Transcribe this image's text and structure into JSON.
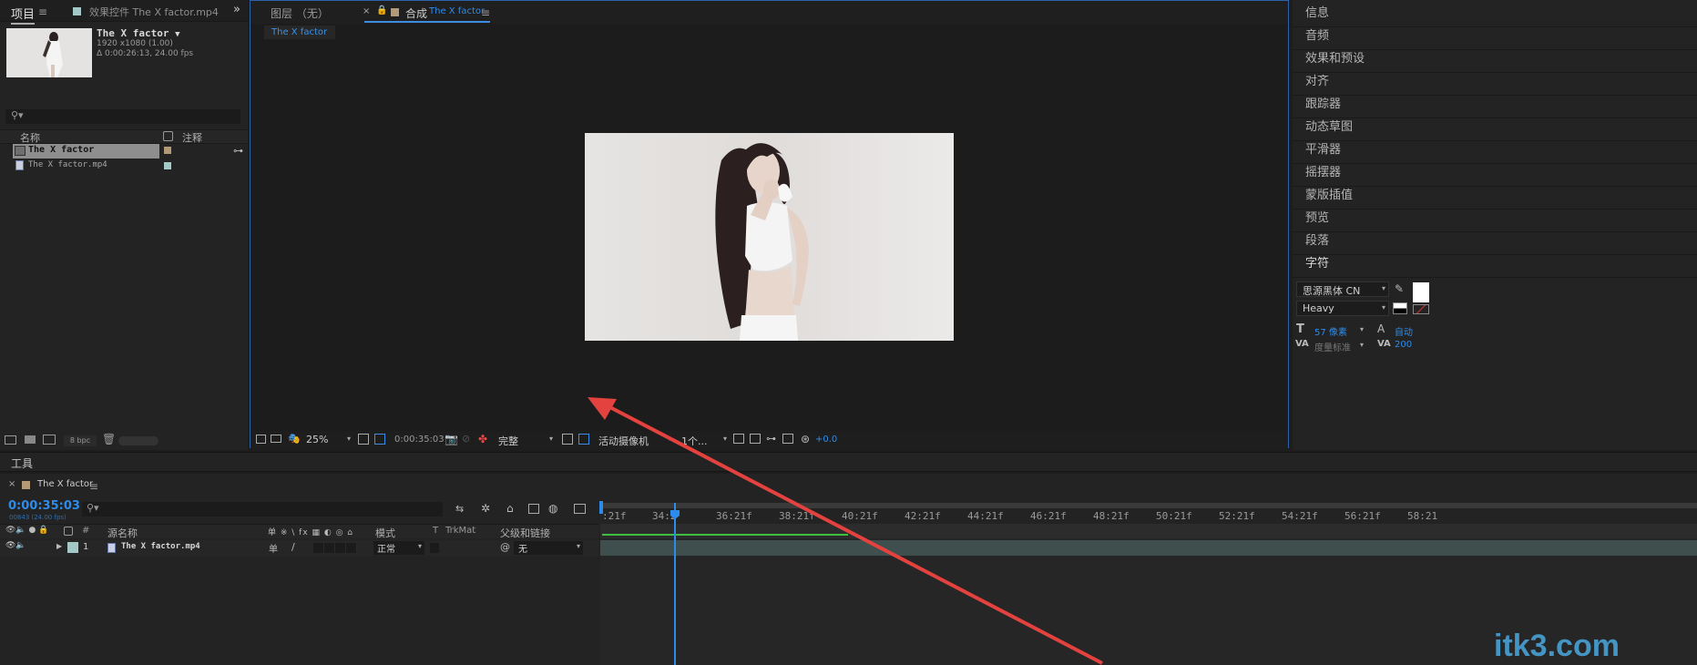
{
  "project_panel": {
    "tab_project": "项目",
    "tab_effects": "效果控件 The X factor.mp4",
    "thumb_name": "The X factor",
    "thumb_res": "1920 x1080 (1.00)",
    "thumb_dur": "Δ 0:00:26:13, 24.00 fps",
    "col_name": "名称",
    "col_comment": "注释",
    "items": [
      {
        "name": "The X factor",
        "label_color": "#b39a76"
      },
      {
        "name": "The X factor.mp4",
        "label_color": "#a3c8c5"
      }
    ],
    "bpc": "8 bpc"
  },
  "comp_panel": {
    "tab_layer": "图层 （无）",
    "tab_comp_prefix": "合成",
    "tab_comp_name": "The X factor",
    "sub_tab": "The X factor",
    "zoom": "25%",
    "timecode": "0:00:35:03",
    "quality": "完整",
    "camera": "活动摄像机",
    "views": "1个...",
    "exposure": "+0.0"
  },
  "right_panel": {
    "items": [
      "信息",
      "音频",
      "效果和预设",
      "对齐",
      "跟踪器",
      "动态草图",
      "平滑器",
      "摇摆器",
      "蒙版插值",
      "预览",
      "段落",
      "字符"
    ],
    "font_family": "思源黑体 CN",
    "font_style": "Heavy",
    "font_size": "57 像素",
    "leading": "自动",
    "kerning": "度量标准",
    "tracking": "200"
  },
  "tools_panel": {
    "title": "工具"
  },
  "timeline": {
    "tab_name": "The X factor",
    "timecode": "0:00:35:03",
    "frames": "00843 (24.00 fps)",
    "col_source": "源名称",
    "col_switches": "单 ※ \\ fx ▦ ◐ ◎ ⌂",
    "col_mode": "模式",
    "col_t": "T",
    "col_trkmat": "TrkMat",
    "col_parent": "父级和链接",
    "ruler": [
      ":21f",
      "34:2",
      "36:21f",
      "38:21f",
      "40:21f",
      "42:21f",
      "44:21f",
      "46:21f",
      "48:21f",
      "50:21f",
      "52:21f",
      "54:21f",
      "56:21f",
      "58:21"
    ],
    "layer": {
      "num": "1",
      "name": "The X factor.mp4",
      "mode": "正常",
      "parent": "无",
      "label_color": "#a3c8c5"
    }
  },
  "watermark": "itk3.com"
}
